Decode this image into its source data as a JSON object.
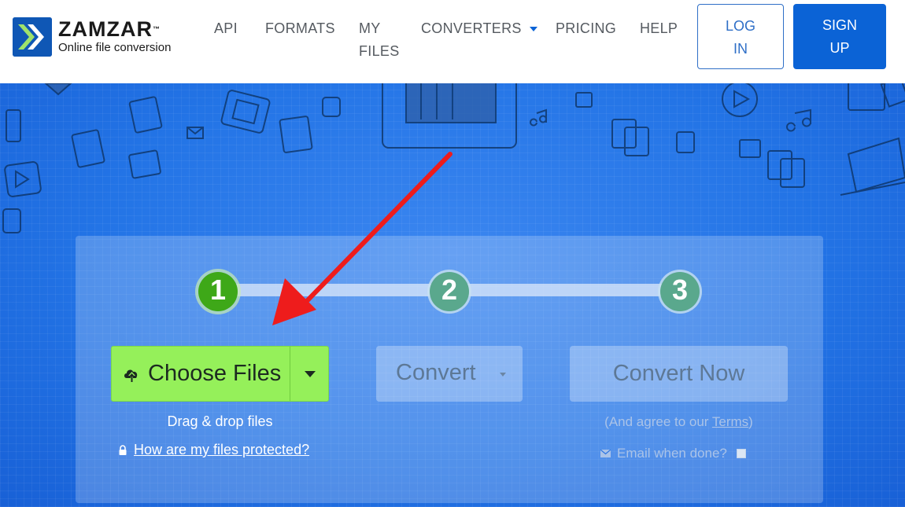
{
  "brand": {
    "name": "ZAMZAR",
    "trademark": "™",
    "tagline": "Online file conversion"
  },
  "nav": {
    "api": "API",
    "formats": "FORMATS",
    "my_files_line1": "MY",
    "my_files_line2": "FILES",
    "converters": "CONVERTERS",
    "pricing": "PRICING",
    "help": "HELP",
    "login_line1": "LOG",
    "login_line2": "IN",
    "signup_line1": "SIGN",
    "signup_line2": "UP"
  },
  "steps": {
    "one": "1",
    "two": "2",
    "three": "3"
  },
  "converter": {
    "choose_files": "Choose Files",
    "convert": "Convert",
    "convert_now": "Convert Now",
    "drag_drop": "Drag & drop files",
    "protected_link": "How are my files protected?",
    "agree_prefix": "(And agree to our ",
    "terms": "Terms",
    "agree_suffix": ")",
    "email_when_done": "Email when done?"
  },
  "colors": {
    "brand_blue": "#0b63d6",
    "choose_green": "#95f05a",
    "step_active": "#3ea818",
    "arrow_red": "#ee1c1c"
  }
}
